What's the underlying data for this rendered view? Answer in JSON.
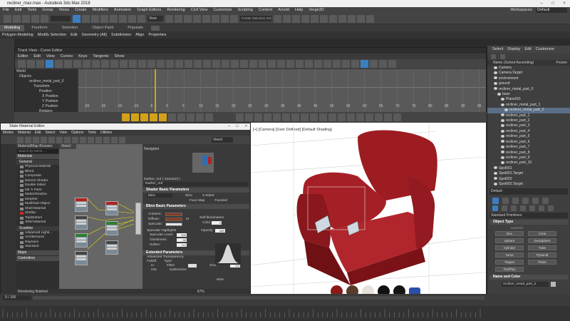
{
  "window": {
    "title": "recliner_max.max - Autodesk 3ds Max 2018",
    "controls": [
      "–",
      "□",
      "×"
    ]
  },
  "menubar": {
    "items": [
      "File",
      "Edit",
      "Tools",
      "Group",
      "Views",
      "Create",
      "Modifiers",
      "Animation",
      "Graph Editors",
      "Rendering",
      "Civil View",
      "Customize",
      "Scripting",
      "Content",
      "Arnold",
      "Help",
      "Verge3D"
    ],
    "workspace_label": "Workspaces:",
    "workspace_value": "Default"
  },
  "toolbar": {
    "view_dropdown": "View",
    "selection_set_placeholder": "Create Selection Set"
  },
  "ribbon": {
    "tabs": [
      "Modeling",
      "Freeform",
      "Selection",
      "Object Paint",
      "Populate"
    ],
    "subtabs": [
      "Polygon Modeling",
      "Modify Selection",
      "Edit",
      "Geometry (All)",
      "Subdivision",
      "Align",
      "Properties"
    ]
  },
  "trackview": {
    "title": "Track View - Curve Editor",
    "menu": [
      "Editor",
      "Edit",
      "View",
      "Curves",
      "Keys",
      "Tangents",
      "Show"
    ],
    "tree": [
      "World",
      "Objects",
      "recliner_metal_part_0",
      "Transform",
      "Position",
      "X Position",
      "Y Position",
      "Z Position",
      "Rotation"
    ],
    "ruler_ticks": [
      "-25",
      "-20",
      "-15",
      "-10",
      "-5",
      "0",
      "5",
      "10",
      "15",
      "20",
      "25",
      "30",
      "35",
      "40",
      "45",
      "50",
      "55",
      "60",
      "65",
      "70",
      "75",
      "80",
      "85",
      "90",
      "95"
    ]
  },
  "viewport": {
    "label": "[+] [Camera] [User Defined] [Default Shading]",
    "swatch_colors": [
      "#8b1a1a",
      "#5a3a2a",
      "#e6e2da",
      "#111111",
      "#151515"
    ]
  },
  "command_panel": {
    "tabs": [
      "Select",
      "Display",
      "Edit",
      "Customize"
    ],
    "sort_label": "Name (Sorted Ascending)",
    "frozen_label": "Frozen",
    "scene": [
      {
        "name": "Camera",
        "indent": 1
      },
      {
        "name": "Camera.Target",
        "indent": 1
      },
      {
        "name": "environment",
        "indent": 1
      },
      {
        "name": "ground",
        "indent": 1
      },
      {
        "name": "recliner_metal_part_0",
        "indent": 1
      },
      {
        "name": "base",
        "indent": 2
      },
      {
        "name": "Plane001",
        "indent": 3
      },
      {
        "name": "recliner_metal_part_1",
        "indent": 3
      },
      {
        "name": "recliner_metal_part_2",
        "indent": 4,
        "selected": true
      },
      {
        "name": "recliner_part_1",
        "indent": 3
      },
      {
        "name": "recliner_part_2",
        "indent": 3
      },
      {
        "name": "recliner_part_3",
        "indent": 3
      },
      {
        "name": "recliner_part_4",
        "indent": 3
      },
      {
        "name": "recliner_part_5",
        "indent": 3
      },
      {
        "name": "recliner_part_6",
        "indent": 3
      },
      {
        "name": "recliner_part_7",
        "indent": 3
      },
      {
        "name": "recliner_part_8",
        "indent": 3
      },
      {
        "name": "recliner_part_9",
        "indent": 3
      },
      {
        "name": "recliner_part_10",
        "indent": 3
      },
      {
        "name": "Spot001",
        "indent": 1
      },
      {
        "name": "Spot001.Target",
        "indent": 1
      },
      {
        "name": "Spot002",
        "indent": 1
      },
      {
        "name": "Spot002.Target",
        "indent": 1
      }
    ],
    "layer_dropdown": "Default",
    "primitives_dropdown": "Standard Primitives",
    "object_type_title": "Object Type",
    "autogrid_label": "AutoGrid",
    "primitives": [
      "Box",
      "Cone",
      "Sphere",
      "GeoSphere",
      "Cylinder",
      "Tube",
      "Torus",
      "Pyramid",
      "Teapot",
      "Plane",
      "TextPlus"
    ],
    "name_color_title": "Name and Color",
    "object_name": "recliner_metal_part_2"
  },
  "slate": {
    "title": "Slate Material Editor",
    "controls": [
      "–",
      "□",
      "×"
    ],
    "menu": [
      "Modes",
      "Material",
      "Edit",
      "Select",
      "View",
      "Options",
      "Tools",
      "Utilities"
    ],
    "browser_title": "Material/Map Browser",
    "search_placeholder": "Search by Name ...",
    "materials_header": "Materials",
    "general_header": "General",
    "general_items": [
      "Physical Material",
      "Blend",
      "Composite",
      "DirectX Shader",
      "Double Sided",
      "Ink 'n Paint",
      "Matte/Shadow",
      "Morpher",
      "Multi/Sub-Object",
      "Shell Material",
      "Shellac",
      "Top/Bottom",
      "XRef Material"
    ],
    "scanline_header": "Scanline",
    "scanline_items": [
      "Advanced Lighti...",
      "Architectural",
      "Raytrace",
      "Standard"
    ],
    "maps_header": "Maps",
    "controllers_header": "Controllers",
    "view_tab": "View1",
    "navigator_title": "Navigator",
    "view_dropdown": "View1",
    "material_name": "leather_red",
    "material_type": "leather_red  ( Standard )",
    "shader_rollout": "Shader Basic Parameters",
    "shader_value": "Blinn",
    "shader_checks": [
      "Wire",
      "2-Sided",
      "Face Map",
      "Faceted"
    ],
    "blinn_rollout": "Blinn Basic Parameters",
    "self_illum": "Self-Illumination",
    "color_label": "Color",
    "color_value": "0",
    "ambient_label": "Ambient:",
    "diffuse_label": "Diffuse:",
    "specular_label": "Specular:",
    "map_letter": "M",
    "opacity_label": "Opacity:",
    "opacity_value": "100",
    "spec_highlights": "Specular Highlights",
    "spec_level_label": "Specular Level:",
    "spec_level_value": "100",
    "glossiness_label": "Glossiness:",
    "glossiness_value": "30",
    "soften_label": "Soften:",
    "soften_value": "0.1",
    "extended_rollout": "Extended Parameters",
    "adv_transp": "Advanced Transparency",
    "falloff_label": "Falloff:",
    "type_label": "Type:",
    "in_label": "In",
    "out_label": "Out",
    "filter_label": "Filter:",
    "subtractive_label": "Subtractive",
    "wire_label": "Wire",
    "size_label": "Size:",
    "size_value": "1.0",
    "status": "Rendering finished",
    "zoom": "57%"
  },
  "status": {
    "frame": "0 / 100"
  }
}
